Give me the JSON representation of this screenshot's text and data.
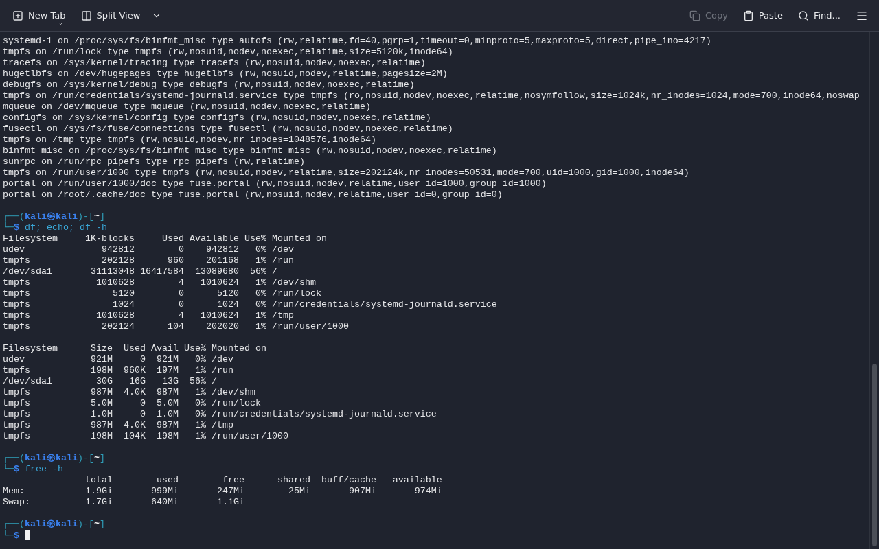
{
  "toolbar": {
    "left": [
      {
        "kind": "new-tab",
        "label": "New Tab",
        "disabled": false
      },
      {
        "kind": "split-view",
        "label": "Split View",
        "disabled": false
      }
    ],
    "right": [
      {
        "kind": "copy",
        "label": "Copy",
        "disabled": true
      },
      {
        "kind": "paste",
        "label": "Paste",
        "disabled": false
      },
      {
        "kind": "find",
        "label": "Find...",
        "disabled": false
      }
    ]
  },
  "terminal": {
    "lines": [
      {
        "kind": "text",
        "text": "systemd-1 on /proc/sys/fs/binfmt_misc type autofs (rw,relatime,fd=40,pgrp=1,timeout=0,minproto=5,maxproto=5,direct,pipe_ino=4217)"
      },
      {
        "kind": "text",
        "text": "tmpfs on /run/lock type tmpfs (rw,nosuid,nodev,noexec,relatime,size=5120k,inode64)"
      },
      {
        "kind": "text",
        "text": "tracefs on /sys/kernel/tracing type tracefs (rw,nosuid,nodev,noexec,relatime)"
      },
      {
        "kind": "text",
        "text": "hugetlbfs on /dev/hugepages type hugetlbfs (rw,nosuid,nodev,relatime,pagesize=2M)"
      },
      {
        "kind": "text",
        "text": "debugfs on /sys/kernel/debug type debugfs (rw,nosuid,nodev,noexec,relatime)"
      },
      {
        "kind": "text",
        "text": "tmpfs on /run/credentials/systemd-journald.service type tmpfs (ro,nosuid,nodev,noexec,relatime,nosymfollow,size=1024k,nr_inodes=1024,mode=700,inode64,noswap"
      },
      {
        "kind": "text",
        "text": "mqueue on /dev/mqueue type mqueue (rw,nosuid,nodev,noexec,relatime)"
      },
      {
        "kind": "text",
        "text": "configfs on /sys/kernel/config type configfs (rw,nosuid,nodev,noexec,relatime)"
      },
      {
        "kind": "text",
        "text": "fusectl on /sys/fs/fuse/connections type fusectl (rw,nosuid,nodev,noexec,relatime)"
      },
      {
        "kind": "text",
        "text": "tmpfs on /tmp type tmpfs (rw,nosuid,nodev,nr_inodes=1048576,inode64)"
      },
      {
        "kind": "text",
        "text": "binfmt_misc on /proc/sys/fs/binfmt_misc type binfmt_misc (rw,nosuid,nodev,noexec,relatime)"
      },
      {
        "kind": "text",
        "text": "sunrpc on /run/rpc_pipefs type rpc_pipefs (rw,relatime)"
      },
      {
        "kind": "text",
        "text": "tmpfs on /run/user/1000 type tmpfs (rw,nosuid,nodev,relatime,size=202124k,nr_inodes=50531,mode=700,uid=1000,gid=1000,inode64)"
      },
      {
        "kind": "text",
        "text": "portal on /run/user/1000/doc type fuse.portal (rw,nosuid,nodev,relatime,user_id=1000,group_id=1000)"
      },
      {
        "kind": "text",
        "text": "portal on /root/.cache/doc type fuse.portal (rw,nosuid,nodev,relatime,user_id=0,group_id=0)"
      },
      {
        "kind": "blank"
      },
      {
        "kind": "prompt",
        "open": "┌──(",
        "user": "kali",
        "at": "㉿",
        "host": "kali",
        "mid": ")-[",
        "dir": "~",
        "close": "]",
        "corner": "└─",
        "dollar": "$",
        "command": "df; echo; df -h",
        "cursor": false
      },
      {
        "kind": "text",
        "text": "Filesystem     1K-blocks     Used Available Use% Mounted on"
      },
      {
        "kind": "text",
        "text": "udev              942812        0    942812   0% /dev"
      },
      {
        "kind": "text",
        "text": "tmpfs             202128      960    201168   1% /run"
      },
      {
        "kind": "text",
        "text": "/dev/sda1       31113048 16417584  13089680  56% /"
      },
      {
        "kind": "text",
        "text": "tmpfs            1010628        4   1010624   1% /dev/shm"
      },
      {
        "kind": "text",
        "text": "tmpfs               5120        0      5120   0% /run/lock"
      },
      {
        "kind": "text",
        "text": "tmpfs               1024        0      1024   0% /run/credentials/systemd-journald.service"
      },
      {
        "kind": "text",
        "text": "tmpfs            1010628        4   1010624   1% /tmp"
      },
      {
        "kind": "text",
        "text": "tmpfs             202124      104    202020   1% /run/user/1000"
      },
      {
        "kind": "blank"
      },
      {
        "kind": "text",
        "text": "Filesystem      Size  Used Avail Use% Mounted on"
      },
      {
        "kind": "text",
        "text": "udev            921M     0  921M   0% /dev"
      },
      {
        "kind": "text",
        "text": "tmpfs           198M  960K  197M   1% /run"
      },
      {
        "kind": "text",
        "text": "/dev/sda1        30G   16G   13G  56% /"
      },
      {
        "kind": "text",
        "text": "tmpfs           987M  4.0K  987M   1% /dev/shm"
      },
      {
        "kind": "text",
        "text": "tmpfs           5.0M     0  5.0M   0% /run/lock"
      },
      {
        "kind": "text",
        "text": "tmpfs           1.0M     0  1.0M   0% /run/credentials/systemd-journald.service"
      },
      {
        "kind": "text",
        "text": "tmpfs           987M  4.0K  987M   1% /tmp"
      },
      {
        "kind": "text",
        "text": "tmpfs           198M  104K  198M   1% /run/user/1000"
      },
      {
        "kind": "blank"
      },
      {
        "kind": "prompt",
        "open": "┌──(",
        "user": "kali",
        "at": "㉿",
        "host": "kali",
        "mid": ")-[",
        "dir": "~",
        "close": "]",
        "corner": "└─",
        "dollar": "$",
        "command": "free -h",
        "cursor": false
      },
      {
        "kind": "text",
        "text": "               total        used        free      shared  buff/cache   available"
      },
      {
        "kind": "text",
        "text": "Mem:           1.9Gi       999Mi       247Mi        25Mi       907Mi       974Mi"
      },
      {
        "kind": "text",
        "text": "Swap:          1.7Gi       640Mi       1.1Gi"
      },
      {
        "kind": "blank"
      },
      {
        "kind": "prompt",
        "open": "┌──(",
        "user": "kali",
        "at": "㉿",
        "host": "kali",
        "mid": ")-[",
        "dir": "~",
        "close": "]",
        "corner": "└─",
        "dollar": "$",
        "cursor": true
      }
    ]
  }
}
